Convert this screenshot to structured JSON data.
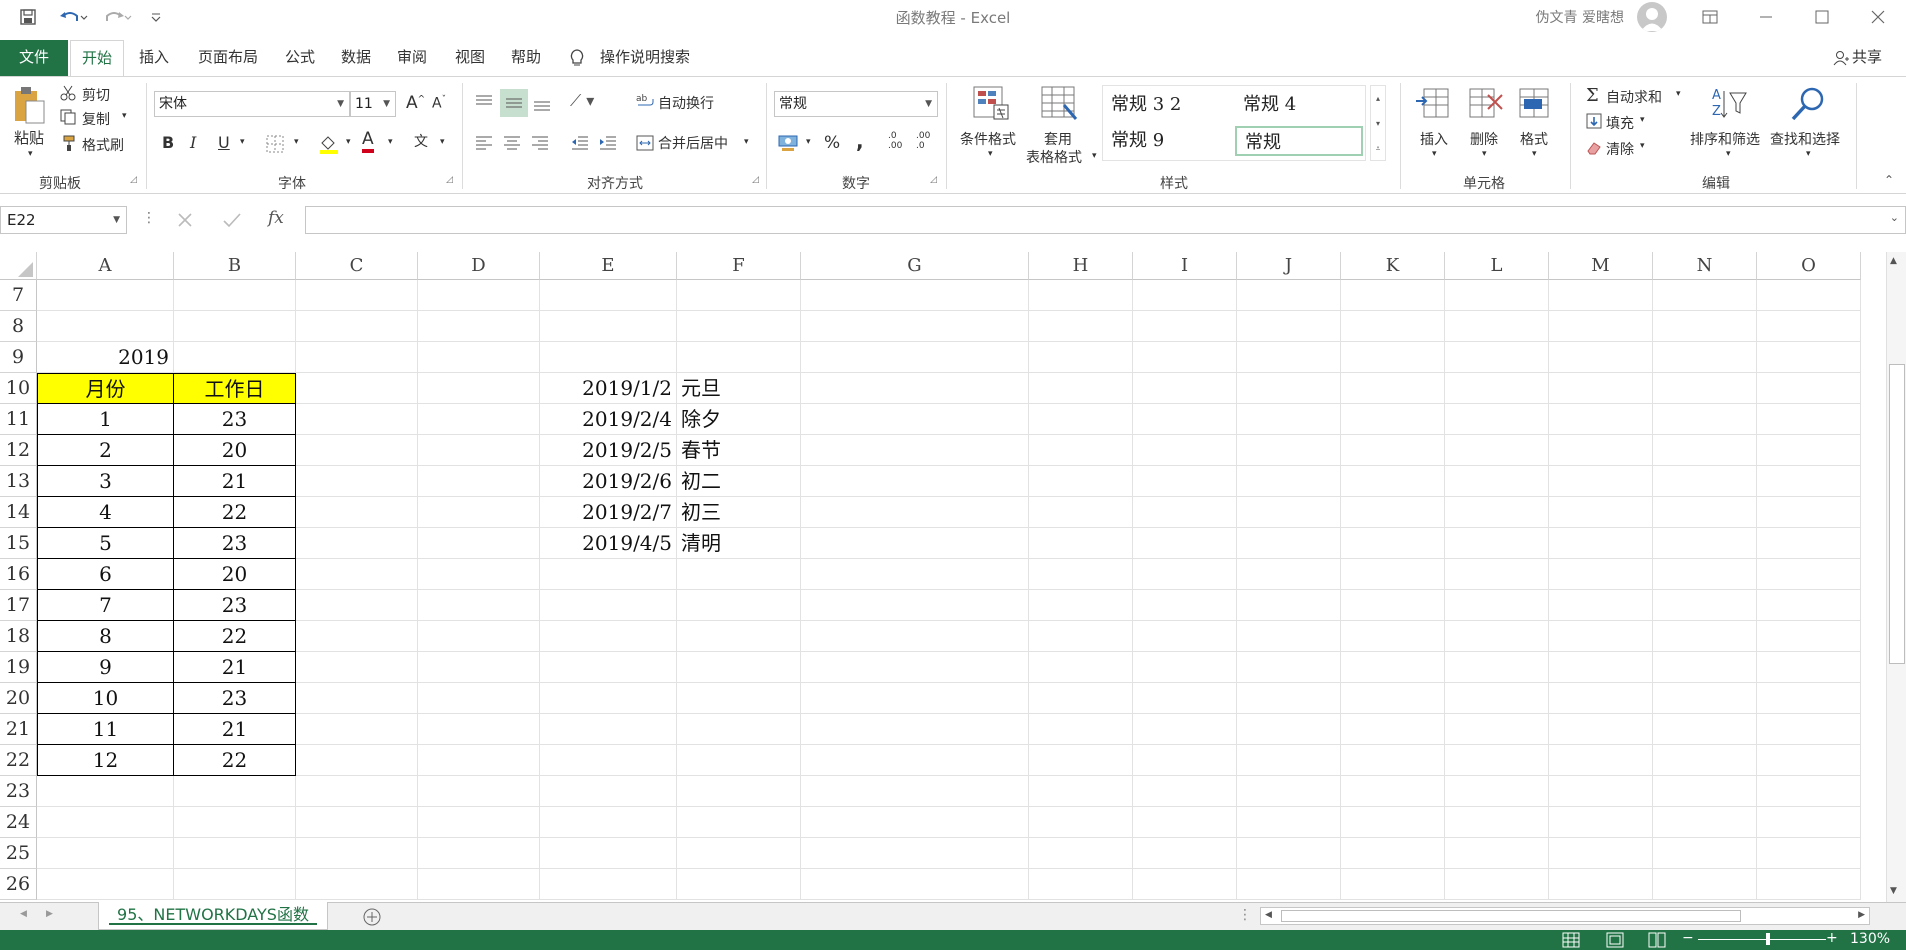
{
  "window": {
    "title": "函数教程  -  Excel",
    "user": "伪文青 爱瞎想"
  },
  "tabs": {
    "file": "文件",
    "home": "开始",
    "insert": "插入",
    "page_layout": "页面布局",
    "formulas": "公式",
    "data": "数据",
    "review": "审阅",
    "view": "视图",
    "help": "帮助",
    "tell_me": "操作说明搜索",
    "share": "共享"
  },
  "ribbon": {
    "clipboard": {
      "paste": "粘贴",
      "cut": "剪切",
      "copy": "复制",
      "format_painter": "格式刷",
      "label": "剪贴板"
    },
    "font": {
      "name": "宋体",
      "size": "11",
      "label": "字体",
      "bold": "B",
      "italic": "I",
      "underline": "U",
      "font_color_glyph": "A",
      "phonetic_glyph": "文"
    },
    "alignment": {
      "wrap": "自动换行",
      "merge": "合并后居中",
      "label": "对齐方式"
    },
    "number": {
      "format": "常规",
      "percent": "%",
      "comma": ",",
      "inc_decimal": ".0 .00",
      "dec_decimal": ".00 .0",
      "label": "数字"
    },
    "styles": {
      "conditional": "条件格式",
      "table_format_1": "套用",
      "table_format_2": "表格格式",
      "style_normal_32": "常规 3 2",
      "style_normal_4": "常规 4",
      "style_normal_9": "常规 9",
      "style_normal": "常规",
      "label": "样式"
    },
    "cells": {
      "insert": "插入",
      "delete": "删除",
      "format": "格式",
      "label": "单元格"
    },
    "editing": {
      "autosum": "自动求和",
      "fill": "填充",
      "clear": "清除",
      "sort": "排序和筛选",
      "find": "查找和选择",
      "label": "编辑"
    }
  },
  "formula_bar": {
    "name_box": "E22",
    "fx": "fx",
    "value": ""
  },
  "sheet": {
    "columns": [
      "A",
      "B",
      "C",
      "D",
      "E",
      "F",
      "G",
      "H",
      "I",
      "J",
      "K",
      "L",
      "M",
      "N",
      "O"
    ],
    "rows": [
      "7",
      "8",
      "9",
      "10",
      "11",
      "12",
      "13",
      "14",
      "15",
      "16",
      "17",
      "18",
      "19",
      "20",
      "21",
      "22",
      "23",
      "24",
      "25",
      "26"
    ],
    "year": "2019",
    "header_month": "月份",
    "header_workdays": "工作日",
    "table": [
      {
        "month": "1",
        "days": "23"
      },
      {
        "month": "2",
        "days": "20"
      },
      {
        "month": "3",
        "days": "21"
      },
      {
        "month": "4",
        "days": "22"
      },
      {
        "month": "5",
        "days": "23"
      },
      {
        "month": "6",
        "days": "20"
      },
      {
        "month": "7",
        "days": "23"
      },
      {
        "month": "8",
        "days": "22"
      },
      {
        "month": "9",
        "days": "21"
      },
      {
        "month": "10",
        "days": "23"
      },
      {
        "month": "11",
        "days": "21"
      },
      {
        "month": "12",
        "days": "22"
      }
    ],
    "holidays": [
      {
        "date": "2019/1/2",
        "name": "元旦"
      },
      {
        "date": "2019/2/4",
        "name": "除夕"
      },
      {
        "date": "2019/2/5",
        "name": "春节"
      },
      {
        "date": "2019/2/6",
        "name": "初二"
      },
      {
        "date": "2019/2/7",
        "name": "初三"
      },
      {
        "date": "2019/4/5",
        "name": "清明"
      }
    ]
  },
  "sheet_tab": {
    "name": "95、NETWORKDAYS函数"
  },
  "status": {
    "zoom": "130%",
    "accent": "#217346"
  }
}
